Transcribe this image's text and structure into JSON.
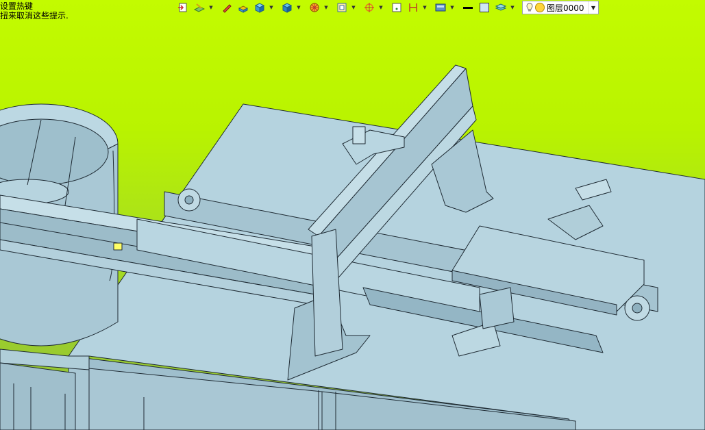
{
  "hint": {
    "line1": "设置热键",
    "line2": "扭来取消这些提示."
  },
  "toolbar": {
    "buttons": [
      {
        "icon": "exit-sketch-icon",
        "has_dropdown": false
      },
      {
        "icon": "sketch-plane-icon",
        "has_dropdown": true
      },
      {
        "icon": "pencil-icon",
        "has_dropdown": false
      },
      {
        "icon": "extrude-icon",
        "has_dropdown": false
      },
      {
        "icon": "solid-cube-icon",
        "has_dropdown": true
      },
      {
        "icon": "surface-cube-icon",
        "has_dropdown": true
      },
      {
        "icon": "wheel-icon",
        "has_dropdown": true
      },
      {
        "icon": "frame-icon",
        "has_dropdown": true
      },
      {
        "icon": "target-icon",
        "has_dropdown": true
      },
      {
        "icon": "point-icon",
        "has_dropdown": false
      },
      {
        "icon": "dimension-icon",
        "has_dropdown": true
      },
      {
        "icon": "display-mode-icon",
        "has_dropdown": true
      },
      {
        "icon": "line-color-icon",
        "has_dropdown": false
      },
      {
        "icon": "fill-color-icon",
        "has_dropdown": false
      },
      {
        "icon": "layers-icon",
        "has_dropdown": true
      }
    ],
    "layer_selector": {
      "value": "图层0000"
    }
  },
  "colors": {
    "background_top": "#c3fb00",
    "background_bottom": "#8fbd3a",
    "model_face": "#b5d3df",
    "model_face_dark": "#8fb2c2",
    "model_edge": "#1e2a33"
  }
}
